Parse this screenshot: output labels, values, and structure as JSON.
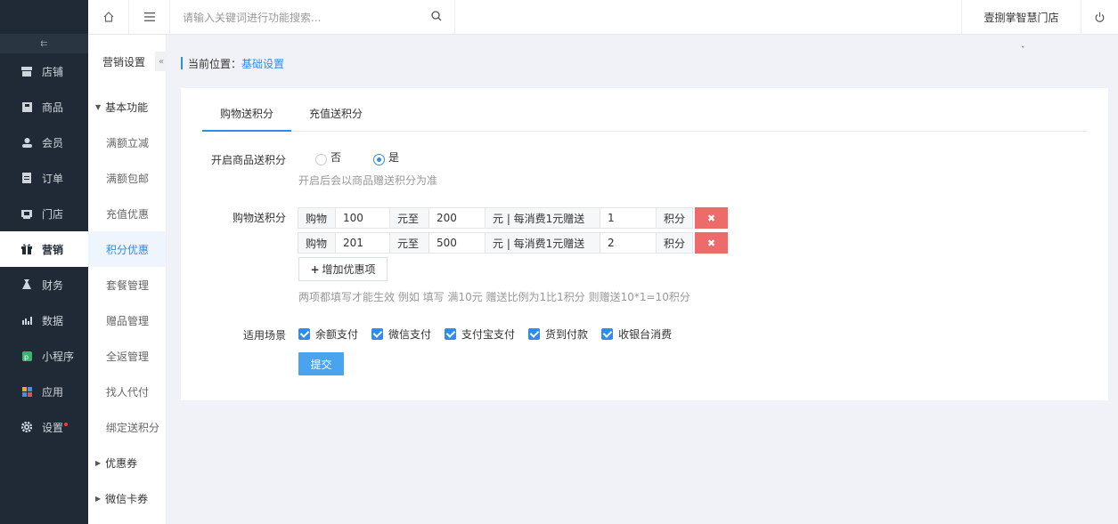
{
  "topbar": {
    "search_placeholder": "请输入关键词进行功能搜索...",
    "store_name": "壹捌掌智慧门店"
  },
  "nav": {
    "toggle_icon": "list-toggle-icon",
    "items": [
      {
        "label": "店铺",
        "icon": "store-icon"
      },
      {
        "label": "商品",
        "icon": "goods-icon"
      },
      {
        "label": "会员",
        "icon": "user-icon"
      },
      {
        "label": "订单",
        "icon": "order-icon"
      },
      {
        "label": "门店",
        "icon": "shop-icon"
      },
      {
        "label": "营销",
        "icon": "gift-icon",
        "active": true
      },
      {
        "label": "财务",
        "icon": "finance-icon"
      },
      {
        "label": "数据",
        "icon": "chart-icon"
      },
      {
        "label": "小程序",
        "icon": "miniprogram-icon"
      },
      {
        "label": "应用",
        "icon": "apps-icon"
      },
      {
        "label": "设置",
        "icon": "gear-icon",
        "badge": true
      }
    ]
  },
  "submenu": {
    "title": "营销设置",
    "group1": "基本功能",
    "items": [
      "满额立减",
      "满额包邮",
      "充值优惠",
      "积分优惠",
      "套餐管理",
      "赠品管理",
      "全返管理",
      "找人代付",
      "绑定送积分"
    ],
    "active_index": 3,
    "group2": "优惠券",
    "group3": "微信卡券"
  },
  "breadcrumb": {
    "prefix": "当前位置：",
    "current": "基础设置"
  },
  "tabs": [
    "购物送积分",
    "充值送积分"
  ],
  "form": {
    "enable_label": "开启商品送积分",
    "option_no": "否",
    "option_yes": "是",
    "selected": "是",
    "enable_hint": "开启后会以商品赠送积分为准",
    "rules_label": "购物送积分",
    "rules": [
      {
        "buy": "购物",
        "from": "100",
        "to_text": "元至",
        "to": "200",
        "per_text": "元 | 每消费1元赠送",
        "points": "1",
        "unit": "积分"
      },
      {
        "buy": "购物",
        "from": "201",
        "to_text": "元至",
        "to": "500",
        "per_text": "元 | 每消费1元赠送",
        "points": "2",
        "unit": "积分"
      }
    ],
    "add_label": "增加优惠项",
    "rules_hint": "两项都填写才能生效 例如 填写 满10元 赠送比例为1比1积分 则赠送10*1=10积分",
    "scene_label": "适用场景",
    "scenes": [
      "余额支付",
      "微信支付",
      "支付宝支付",
      "货到付款",
      "收银台消费"
    ],
    "submit_label": "提交"
  },
  "colors": {
    "accent": "#2d8cf0",
    "nav_bg": "#1f2a36",
    "delete": "#ee6b6b",
    "submit": "#4aa3ef"
  }
}
